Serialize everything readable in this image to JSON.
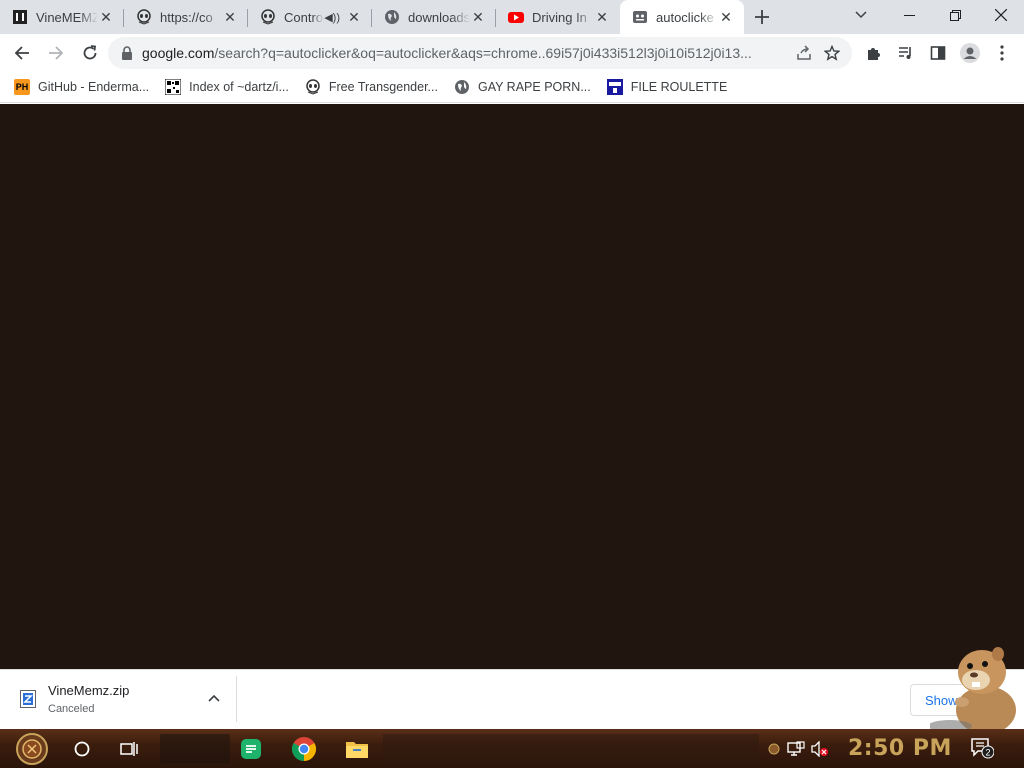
{
  "tabs": [
    {
      "title": "VineMEMZ",
      "icon": "vinememz-icon",
      "active": false
    },
    {
      "title": "https://co",
      "icon": "alien-icon",
      "active": false
    },
    {
      "title": "Contro",
      "icon": "alien-icon",
      "active": false,
      "audio": true
    },
    {
      "title": "downloads",
      "icon": "globe-icon",
      "active": false
    },
    {
      "title": "Driving In",
      "icon": "youtube-icon",
      "active": false
    },
    {
      "title": "autoclicke",
      "icon": "page-icon",
      "active": true
    }
  ],
  "omnibox": {
    "domain": "google.com",
    "path": "/search?q=autoclicker&oq=autoclicker&aqs=chrome..69i57j0i433i512l3j0i10i512j0i13..."
  },
  "bookmarks": [
    {
      "label": "GitHub - Enderma...",
      "icon": "ph-icon",
      "badge": "PH"
    },
    {
      "label": "Index of ~dartz/i...",
      "icon": "qr-icon"
    },
    {
      "label": "Free Transgender...",
      "icon": "alien-icon"
    },
    {
      "label": "GAY RAPE PORN...",
      "icon": "globe-icon"
    },
    {
      "label": "FILE ROULETTE",
      "icon": "mft-icon"
    }
  ],
  "download": {
    "filename": "VineMemz.zip",
    "status": "Canceled",
    "show_all_label": "Show"
  },
  "taskbar": {
    "clock": "2:50 PM",
    "notification_count": "2"
  },
  "colors": {
    "content_bg": "#20150f",
    "tabstrip_bg": "#dee1e6",
    "clock": "#c8a35a"
  }
}
